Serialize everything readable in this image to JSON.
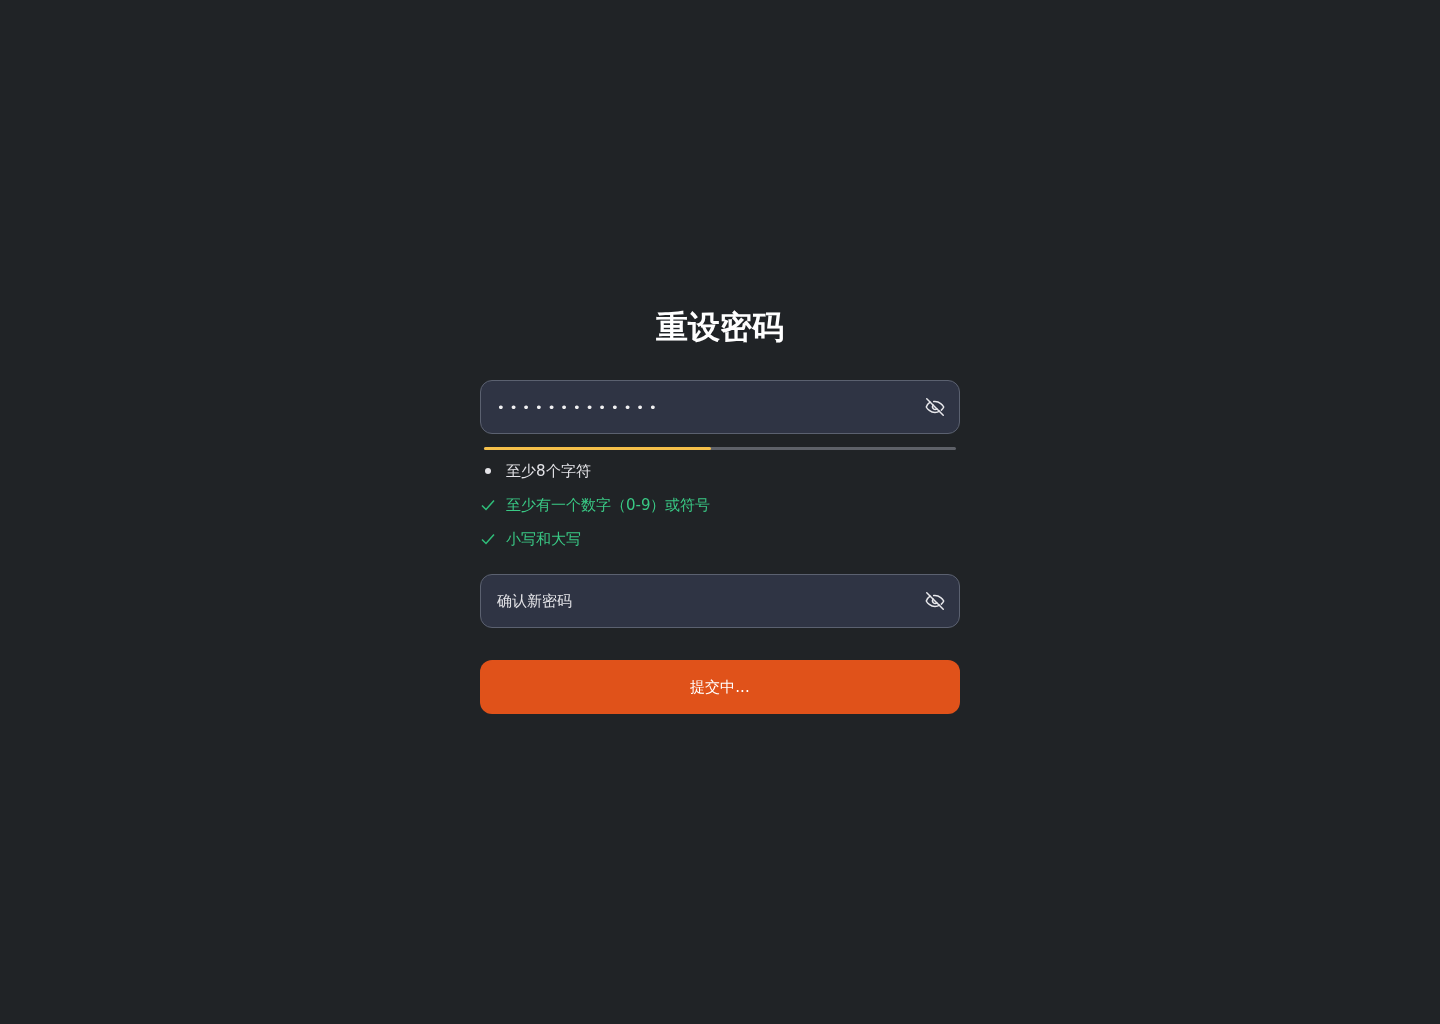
{
  "title": "重设密码",
  "password_field": {
    "value": "•••••••••••••",
    "revealed": false
  },
  "strength_meter": {
    "level": 0.48
  },
  "rules": [
    {
      "text": "至少8个字符",
      "met": false
    },
    {
      "text": "至少有一个数字（0-9）或符号",
      "met": true
    },
    {
      "text": "小写和大写",
      "met": true
    }
  ],
  "confirm_field": {
    "placeholder": "确认新密码",
    "revealed": false
  },
  "submit_button": {
    "label": "提交中...",
    "disabled": false
  }
}
